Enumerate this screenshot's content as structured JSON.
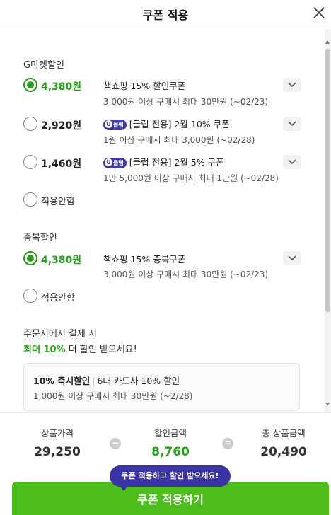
{
  "header": {
    "title": "쿠폰 적용"
  },
  "gmarket": {
    "title": "G마켓할인",
    "options": [
      {
        "amount": "4,380원",
        "selected": true,
        "badge": "",
        "name": "책쇼핑 15% 할인쿠폰",
        "desc": "3,000원 이상 구매시 최대 30만원 (~02/23)"
      },
      {
        "amount": "2,920원",
        "selected": false,
        "badge": "클럽",
        "name": "[클럽 전용] 2월 10% 쿠폰",
        "desc": "1원 이상 구매시 최대 3,000원 (~02/28)"
      },
      {
        "amount": "1,460원",
        "selected": false,
        "badge": "클럽",
        "name": "[클럽 전용] 2월 5% 쿠폰",
        "desc": "1만 5,000원 이상 구매시 최대 1만원 (~02/28)"
      }
    ],
    "no_apply": "적용안함"
  },
  "duplicate": {
    "title": "중복할인",
    "option": {
      "amount": "4,380원",
      "selected": true,
      "name": "책쇼핑 15% 중복쿠폰",
      "desc": "3,000원 이상 구매시 최대 30만원 (~02/23)"
    },
    "no_apply": "적용안함"
  },
  "promo": {
    "line1": "주문서에서 결제 시",
    "highlight": "최대 10%",
    "line2_rest": " 더 할인 받으세요!"
  },
  "card": {
    "bold": "10% 즉시할인",
    "separator": "|",
    "rest": "6대 카드사 10% 할인",
    "desc": "1,000원 이상 구매시 최대 30만원 (~2/28)"
  },
  "summary": {
    "price_label": "상품가격",
    "price": "29,250",
    "minus": "−",
    "discount_label": "할인금액",
    "discount": "8,760",
    "equals": "=",
    "total_label": "총 상품금액",
    "total": "20,490"
  },
  "tooltip": "쿠폰 적용하고 할인 받으세요!",
  "apply_button": "쿠폰 적용하기",
  "colors": {
    "accent_green": "#2a9d1f",
    "button_green": "#4cbe1b",
    "club_purple": "#3f39a8"
  }
}
